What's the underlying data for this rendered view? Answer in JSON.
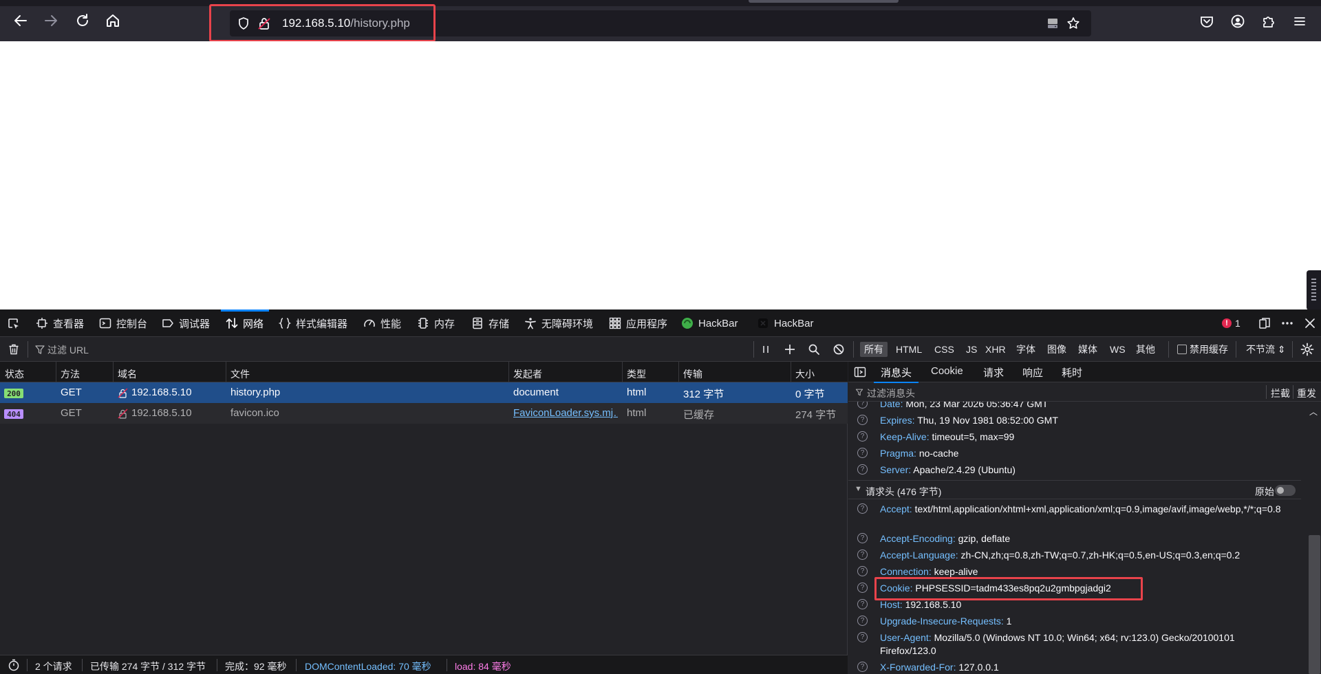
{
  "browser": {
    "url_host": "192.168.5.10",
    "url_path": "/history.php"
  },
  "devtools": {
    "tabs": [
      {
        "label": "查看器",
        "icon": "inspector-icon"
      },
      {
        "label": "控制台",
        "icon": "console-icon"
      },
      {
        "label": "调试器",
        "icon": "debugger-icon"
      },
      {
        "label": "网络",
        "icon": "network-icon",
        "active": true
      },
      {
        "label": "样式编辑器",
        "icon": "style-editor-icon"
      },
      {
        "label": "性能",
        "icon": "performance-icon"
      },
      {
        "label": "内存",
        "icon": "memory-icon"
      },
      {
        "label": "存储",
        "icon": "storage-icon"
      },
      {
        "label": "无障碍环境",
        "icon": "accessibility-icon"
      },
      {
        "label": "应用程序",
        "icon": "application-icon"
      },
      {
        "label": "HackBar",
        "icon": "hackbar-icon"
      },
      {
        "label": "HackBar",
        "icon": "hackbar-dark-icon"
      }
    ],
    "error_count": "1"
  },
  "network": {
    "filter_placeholder": "过滤 URL",
    "type_filters": [
      "所有",
      "HTML",
      "CSS",
      "JS",
      "XHR",
      "字体",
      "图像",
      "媒体",
      "WS",
      "其他"
    ],
    "disable_cache_label": "禁用缓存",
    "throttle_label": "不节流",
    "columns": [
      "状态",
      "方法",
      "域名",
      "文件",
      "发起者",
      "类型",
      "传输",
      "大小"
    ],
    "rows": [
      {
        "status": "200",
        "method": "GET",
        "domain": "192.168.5.10",
        "file": "history.php",
        "initiator": "document",
        "type": "html",
        "transferred": "312 字节",
        "size": "0 字节"
      },
      {
        "status": "404",
        "method": "GET",
        "domain": "192.168.5.10",
        "file": "favicon.ico",
        "initiator": "FaviconLoader.sys.mj…",
        "type": "html",
        "transferred": "已缓存",
        "size": "274 字节"
      }
    ],
    "statusbar": {
      "requests": "2 个请求",
      "transferred": "已传输 274 字节 / 312 字节",
      "finish": "完成：92 毫秒",
      "dom_loaded": "DOMContentLoaded: 70 毫秒",
      "load": "load: 84 毫秒"
    }
  },
  "details": {
    "tabs": [
      "消息头",
      "Cookie",
      "请求",
      "响应",
      "耗时"
    ],
    "filter_placeholder": "过滤消息头",
    "block_label": "拦截",
    "resend_label": "重发",
    "response_headers": [
      {
        "key": "Date:",
        "value": "Mon, 23 Mar 2026 05:36:47 GMT"
      },
      {
        "key": "Expires:",
        "value": "Thu, 19 Nov 1981 08:52:00 GMT"
      },
      {
        "key": "Keep-Alive:",
        "value": "timeout=5, max=99"
      },
      {
        "key": "Pragma:",
        "value": "no-cache"
      },
      {
        "key": "Server:",
        "value": "Apache/2.4.29 (Ubuntu)"
      }
    ],
    "request_section_title": "请求头 (476 字节)",
    "raw_label": "原始",
    "request_headers": [
      {
        "key": "Accept:",
        "value": "text/html,application/xhtml+xml,application/xml;q=0.9,image/avif,image/webp,*/*;q=0.8"
      },
      {
        "key": "Accept-Encoding:",
        "value": "gzip, deflate"
      },
      {
        "key": "Accept-Language:",
        "value": "zh-CN,zh;q=0.8,zh-TW;q=0.7,zh-HK;q=0.5,en-US;q=0.3,en;q=0.2"
      },
      {
        "key": "Connection:",
        "value": "keep-alive"
      },
      {
        "key": "Cookie:",
        "value": "PHPSESSID=tadm433es8pq2u2gmbpgjadgi2"
      },
      {
        "key": "Host:",
        "value": "192.168.5.10"
      },
      {
        "key": "Upgrade-Insecure-Requests:",
        "value": "1"
      },
      {
        "key": "User-Agent:",
        "value": "Mozilla/5.0 (Windows NT 10.0; Win64; x64; rv:123.0) Gecko/20100101 Firefox/123.0"
      },
      {
        "key": "X-Forwarded-For:",
        "value": "127.0.0.1"
      }
    ]
  },
  "colors": {
    "highlight": "#e8434b",
    "accent": "#0a84ff",
    "selected_row": "#204e8a"
  }
}
